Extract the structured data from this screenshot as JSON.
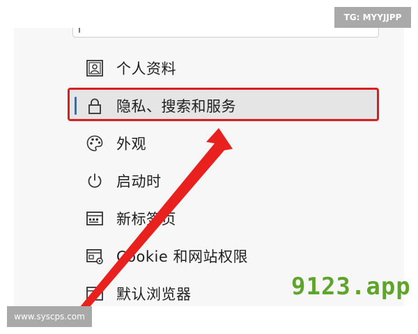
{
  "menu": {
    "items": [
      {
        "label": "个人资料",
        "icon": "profile-icon"
      },
      {
        "label": "隐私、搜索和服务",
        "icon": "lock-icon",
        "selected": true
      },
      {
        "label": "外观",
        "icon": "palette-icon"
      },
      {
        "label": "启动时",
        "icon": "power-icon"
      },
      {
        "label": "新标签页",
        "icon": "new-tab-icon"
      },
      {
        "label": "Cookie 和网站权限",
        "icon": "cookie-settings-icon"
      },
      {
        "label": "默认浏览器",
        "icon": "browser-icon"
      }
    ]
  },
  "overlays": {
    "tg_label": "TG: MYYJJPP",
    "site_label": "www.syscps.com",
    "watermark": "9123.app"
  },
  "colors": {
    "selected_accent": "#2f6ec7",
    "highlight": "#d81e1e",
    "watermark": "#5fa52b",
    "overlay_bg": "#a9a9a9"
  }
}
